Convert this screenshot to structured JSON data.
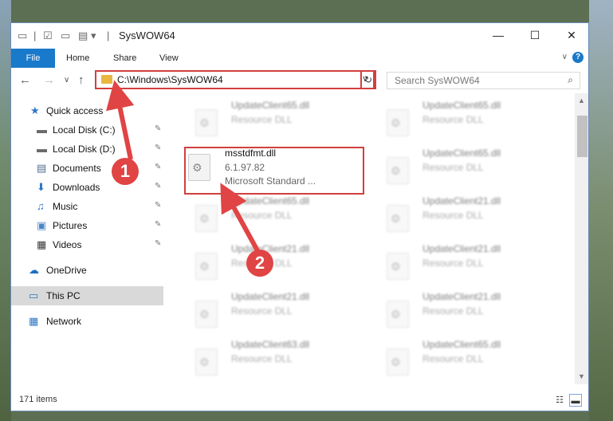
{
  "window": {
    "title": "SysWOW64",
    "controls": {
      "minimize": "—",
      "maximize": "☐",
      "close": "✕"
    }
  },
  "ribbon": {
    "tabs": [
      "File",
      "Home",
      "Share",
      "View"
    ],
    "help": "?",
    "collapse": "∨"
  },
  "nav": {
    "back": "←",
    "forward": "→",
    "recent": "∨",
    "up": "↑"
  },
  "address": {
    "path": "C:\\Windows\\SysWOW64",
    "dropdown": "∨",
    "refresh": "↻"
  },
  "search": {
    "placeholder": "Search SysWOW64",
    "icon": "⌕"
  },
  "sidebar": {
    "items": [
      {
        "label": "Quick access",
        "icon": "★",
        "icon_color": "#2e77c8",
        "pinned": false
      },
      {
        "label": "Local Disk (C:)",
        "icon": "▬",
        "icon_color": "#6a6a6a",
        "pinned": true
      },
      {
        "label": "Local Disk (D:)",
        "icon": "▬",
        "icon_color": "#6a6a6a",
        "pinned": true
      },
      {
        "label": "Documents",
        "icon": "▤",
        "icon_color": "#4f6d8c",
        "pinned": true
      },
      {
        "label": "Downloads",
        "icon": "⬇",
        "icon_color": "#2e77c8",
        "pinned": true
      },
      {
        "label": "Music",
        "icon": "♫",
        "icon_color": "#2e77c8",
        "pinned": true
      },
      {
        "label": "Pictures",
        "icon": "▣",
        "icon_color": "#4a86c5",
        "pinned": true
      },
      {
        "label": "Videos",
        "icon": "▦",
        "icon_color": "#3a3a3a",
        "pinned": true
      },
      {
        "label": "OneDrive",
        "icon": "☁",
        "icon_color": "#1b6ec2",
        "pinned": false
      },
      {
        "label": "This PC",
        "icon": "▭",
        "icon_color": "#2e77c8",
        "pinned": false,
        "selected": true
      },
      {
        "label": "Network",
        "icon": "▦",
        "icon_color": "#2e77c8",
        "pinned": false
      }
    ]
  },
  "files": [
    {
      "name": "UpdateClient65.dll",
      "line2": "Resource DLL",
      "blurred": true
    },
    {
      "name": "UpdateClient65.dll",
      "line2": "Resource DLL",
      "blurred": true
    },
    {
      "name": "msstdfmt.dll",
      "line2": "6.1.97.82",
      "line3": "Microsoft Standard ...",
      "blurred": false
    },
    {
      "name": "UpdateClient65.dll",
      "line2": "Resource DLL",
      "blurred": true
    },
    {
      "name": "UpdateClient65.dll",
      "line2": "Resource DLL",
      "blurred": true
    },
    {
      "name": "UpdateClient21.dll",
      "line2": "Resource DLL",
      "blurred": true
    },
    {
      "name": "UpdateClient21.dll",
      "line2": "Resource DLL",
      "blurred": true
    },
    {
      "name": "UpdateClient21.dll",
      "line2": "Resource DLL",
      "blurred": true
    },
    {
      "name": "UpdateClient21.dll",
      "line2": "Resource DLL",
      "blurred": true
    },
    {
      "name": "UpdateClient21.dll",
      "line2": "Resource DLL",
      "blurred": true
    },
    {
      "name": "UpdateClient63.dll",
      "line2": "Resource DLL",
      "blurred": true
    },
    {
      "name": "UpdateClient65.dll",
      "line2": "Resource DLL",
      "blurred": true
    }
  ],
  "status": {
    "item_count": "171 items"
  },
  "annotations": {
    "step1": "1",
    "step2": "2",
    "color": "#e04444"
  }
}
